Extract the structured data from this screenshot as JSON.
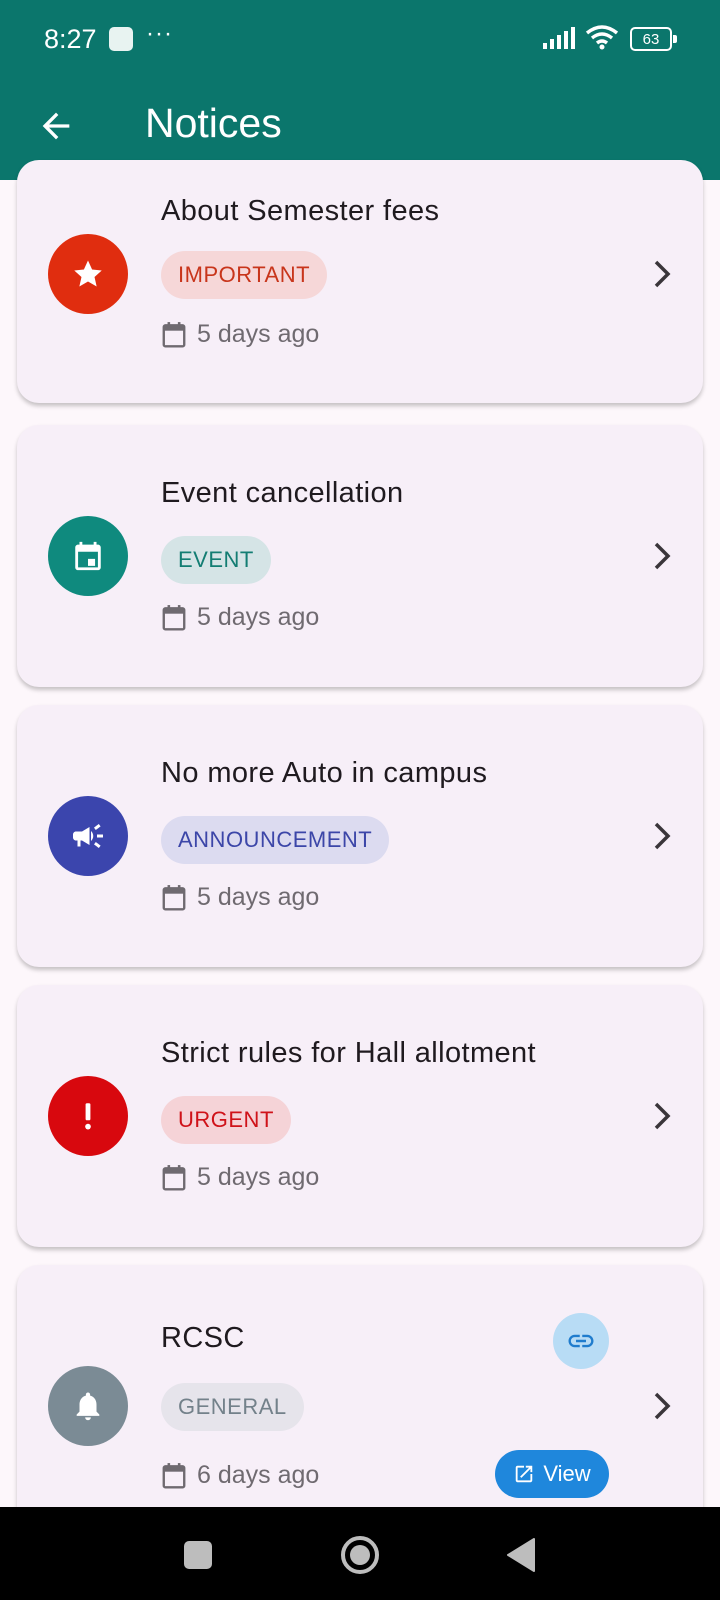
{
  "status_bar": {
    "time": "8:27",
    "dots": "···",
    "battery": "63"
  },
  "app_bar": {
    "title": "Notices",
    "back_icon": "arrow-back-icon"
  },
  "notices": [
    {
      "title": "About Semester fees",
      "category": "IMPORTANT",
      "date": "5 days ago",
      "icon": "star-icon",
      "avatar_color": "#e02d0f",
      "chip_bg": "#f6d7d8",
      "chip_color": "#c8351b"
    },
    {
      "title": "Event cancellation",
      "category": "EVENT",
      "date": "5 days ago",
      "icon": "event-icon",
      "avatar_color": "#0f8a7e",
      "chip_bg": "#d5e4e6",
      "chip_color": "#137d73"
    },
    {
      "title": "No more Auto in campus",
      "category": "ANNOUNCEMENT",
      "date": "5 days ago",
      "icon": "campaign-icon",
      "avatar_color": "#3b45ad",
      "chip_bg": "#dcdbf0",
      "chip_color": "#3c46a8"
    },
    {
      "title": "Strict rules for Hall allotment",
      "category": "URGENT",
      "date": "5 days ago",
      "icon": "priority-icon",
      "avatar_color": "#d8080e",
      "chip_bg": "#f5d3d7",
      "chip_color": "#cf1219"
    },
    {
      "title": "RCSC",
      "category": "GENERAL",
      "date": "6 days ago",
      "icon": "bell-icon",
      "avatar_color": "#7b8b95",
      "chip_bg": "#e6e4eb",
      "chip_color": "#73818a",
      "view_label": "View"
    }
  ]
}
